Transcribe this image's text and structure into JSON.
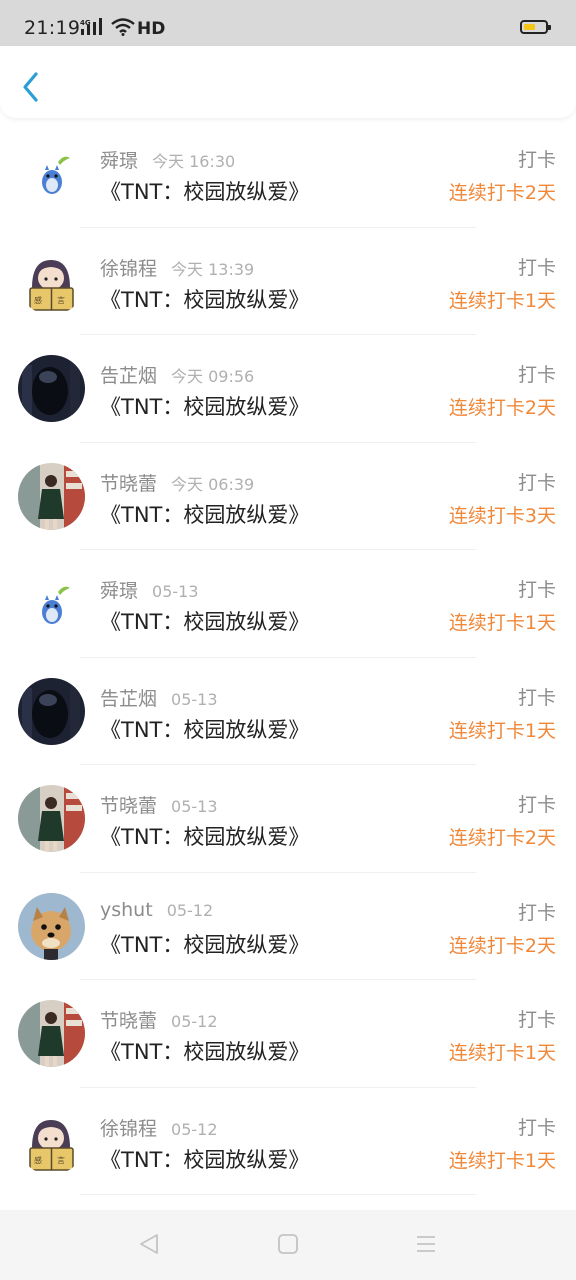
{
  "status_bar": {
    "time": "21:19",
    "network": "4G",
    "hd": "HD",
    "battery_level": 0.55
  },
  "header": {
    "back_icon": "chevron-left-icon"
  },
  "items": [
    {
      "name": "舜璟",
      "time": "今天 16:30",
      "title": "《TNT：校园放纵爱》",
      "tag": "打卡",
      "streak": "连续打卡2天",
      "avatar": "totoro"
    },
    {
      "name": "徐锦程",
      "time": "今天 13:39",
      "title": "《TNT：校园放纵爱》",
      "tag": "打卡",
      "streak": "连续打卡1天",
      "avatar": "reader"
    },
    {
      "name": "告芷烟",
      "time": "今天 09:56",
      "title": "《TNT：校园放纵爱》",
      "tag": "打卡",
      "streak": "连续打卡2天",
      "avatar": "dark"
    },
    {
      "name": "节晓蕾",
      "time": "今天 06:39",
      "title": "《TNT：校园放纵爱》",
      "tag": "打卡",
      "streak": "连续打卡3天",
      "avatar": "street"
    },
    {
      "name": "舜璟",
      "time": "05-13",
      "title": "《TNT：校园放纵爱》",
      "tag": "打卡",
      "streak": "连续打卡1天",
      "avatar": "totoro"
    },
    {
      "name": "告芷烟",
      "time": "05-13",
      "title": "《TNT：校园放纵爱》",
      "tag": "打卡",
      "streak": "连续打卡1天",
      "avatar": "dark"
    },
    {
      "name": "节晓蕾",
      "time": "05-13",
      "title": "《TNT：校园放纵爱》",
      "tag": "打卡",
      "streak": "连续打卡2天",
      "avatar": "street"
    },
    {
      "name": "yshut",
      "time": "05-12",
      "title": "《TNT：校园放纵爱》",
      "tag": "打卡",
      "streak": "连续打卡2天",
      "avatar": "dog"
    },
    {
      "name": "节晓蕾",
      "time": "05-12",
      "title": "《TNT：校园放纵爱》",
      "tag": "打卡",
      "streak": "连续打卡1天",
      "avatar": "street"
    },
    {
      "name": "徐锦程",
      "time": "05-12",
      "title": "《TNT：校园放纵爱》",
      "tag": "打卡",
      "streak": "连续打卡1天",
      "avatar": "reader"
    }
  ],
  "nav_bar": {
    "back": "triangle-back-icon",
    "home": "square-home-icon",
    "menu": "menu-lines-icon"
  },
  "colors": {
    "accent": "#2a9fd6",
    "streak": "#f0883a",
    "name": "#8c8c8c",
    "status_bg": "#d9d9d9"
  }
}
